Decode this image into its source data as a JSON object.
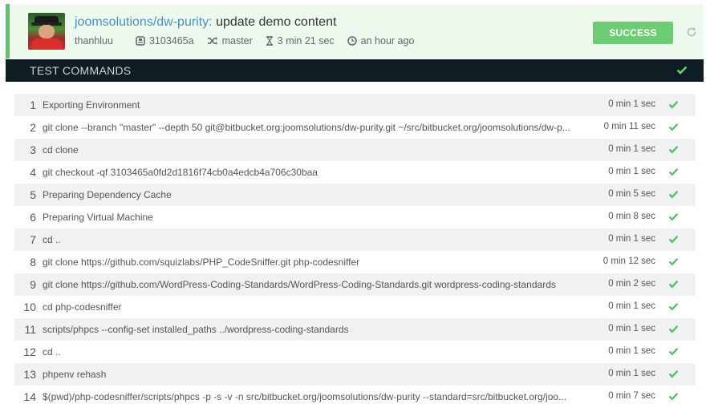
{
  "header": {
    "repo": "joomsolutions/dw-purity:",
    "message": "update demo content",
    "author": "thanhluu",
    "commit": "3103465a",
    "branch": "master",
    "duration": "3 min 21 sec",
    "time_ago": "an hour ago",
    "status_label": "SUCCESS"
  },
  "section": {
    "title": "TEST COMMANDS"
  },
  "colors": {
    "success": "#6ccd73",
    "accent_border": "#5cc26b",
    "section_bg": "#0e1c24",
    "link": "#4b8fbf"
  },
  "commands": [
    {
      "num": "1",
      "cmd": "Exporting Environment",
      "dur": "0 min 1 sec"
    },
    {
      "num": "2",
      "cmd": "git clone --branch \"master\" --depth 50 git@bitbucket.org:joomsolutions/dw-purity.git ~/src/bitbucket.org/joomsolutions/dw-p...",
      "dur": "0 min 11 sec"
    },
    {
      "num": "3",
      "cmd": "cd clone",
      "dur": "0 min 1 sec"
    },
    {
      "num": "4",
      "cmd": "git checkout -qf 3103465a0fd2d1816f74cb0a4edcb4a706c30baa",
      "dur": "0 min 1 sec"
    },
    {
      "num": "5",
      "cmd": "Preparing Dependency Cache",
      "dur": "0 min 5 sec"
    },
    {
      "num": "6",
      "cmd": "Preparing Virtual Machine",
      "dur": "0 min 8 sec"
    },
    {
      "num": "7",
      "cmd": "cd ..",
      "dur": "0 min 1 sec"
    },
    {
      "num": "8",
      "cmd": "git clone https://github.com/squizlabs/PHP_CodeSniffer.git php-codesniffer",
      "dur": "0 min 12 sec"
    },
    {
      "num": "9",
      "cmd": "git clone https://github.com/WordPress-Coding-Standards/WordPress-Coding-Standards.git wordpress-coding-standards",
      "dur": "0 min 2 sec"
    },
    {
      "num": "10",
      "cmd": "cd php-codesniffer",
      "dur": "0 min 1 sec"
    },
    {
      "num": "11",
      "cmd": "scripts/phpcs --config-set installed_paths ../wordpress-coding-standards",
      "dur": "0 min 1 sec"
    },
    {
      "num": "12",
      "cmd": "cd ..",
      "dur": "0 min 1 sec"
    },
    {
      "num": "13",
      "cmd": "phpenv rehash",
      "dur": "0 min 1 sec"
    },
    {
      "num": "14",
      "cmd": "$(pwd)/php-codesniffer/scripts/phpcs -p -s -v -n src/bitbucket.org/joomsolutions/dw-purity --standard=src/bitbucket.org/joo...",
      "dur": "0 min 7 sec"
    }
  ]
}
